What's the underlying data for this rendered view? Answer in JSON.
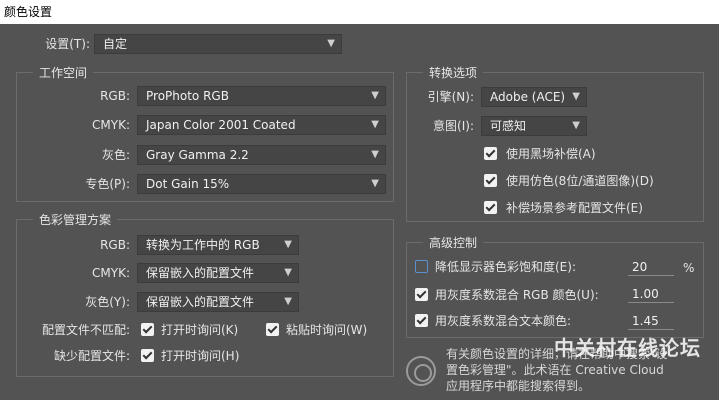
{
  "window": {
    "title": "颜色设置"
  },
  "settings": {
    "label": "设置(T):",
    "value": "自定"
  },
  "working_space": {
    "title": "工作空间",
    "rgb": {
      "label": "RGB:",
      "value": "ProPhoto RGB"
    },
    "cmyk": {
      "label": "CMYK:",
      "value": "Japan Color 2001 Coated"
    },
    "gray": {
      "label": "灰色:",
      "value": "Gray Gamma 2.2"
    },
    "spot": {
      "label": "专色(P):",
      "value": "Dot Gain 15%"
    }
  },
  "color_management": {
    "title": "色彩管理方案",
    "rgb": {
      "label": "RGB:",
      "value": "转换为工作中的 RGB"
    },
    "cmyk": {
      "label": "CMYK:",
      "value": "保留嵌入的配置文件"
    },
    "gray": {
      "label": "灰色(Y):",
      "value": "保留嵌入的配置文件"
    },
    "mismatch": {
      "label": "配置文件不匹配:",
      "open": "打开时询问(K)",
      "paste": "粘贴时询问(W)"
    },
    "missing": {
      "label": "缺少配置文件:",
      "open": "打开时询问(H)"
    }
  },
  "conversion": {
    "title": "转换选项",
    "engine": {
      "label": "引擎(N):",
      "value": "Adobe (ACE)"
    },
    "intent": {
      "label": "意图(I):",
      "value": "可感知"
    },
    "black_point": "使用黑场补偿(A)",
    "dither": "使用仿色(8位/通道图像)(D)",
    "compensate": "补偿场景参考配置文件(E)"
  },
  "advanced": {
    "title": "高级控制",
    "desaturate": {
      "label": "降低显示器色彩饱和度(E):",
      "value": "20",
      "unit": "%"
    },
    "blend_rgb": {
      "label": "用灰度系数混合 RGB 颜色(U):",
      "value": "1.00"
    },
    "blend_text": {
      "label": "用灰度系数混合文本颜色:",
      "value": "1.45"
    }
  },
  "info": {
    "line1": "有关颜色设置的详细，请在帮助中搜索\"设",
    "line2": "置色彩管理\"。此术语在 Creative Cloud",
    "line3": "应用程序中都能搜索得到。"
  },
  "watermark": "中关村在线论坛",
  "colors": {
    "background": "#535353",
    "field": "#454545",
    "accent_blue": "#5a8fd0"
  }
}
